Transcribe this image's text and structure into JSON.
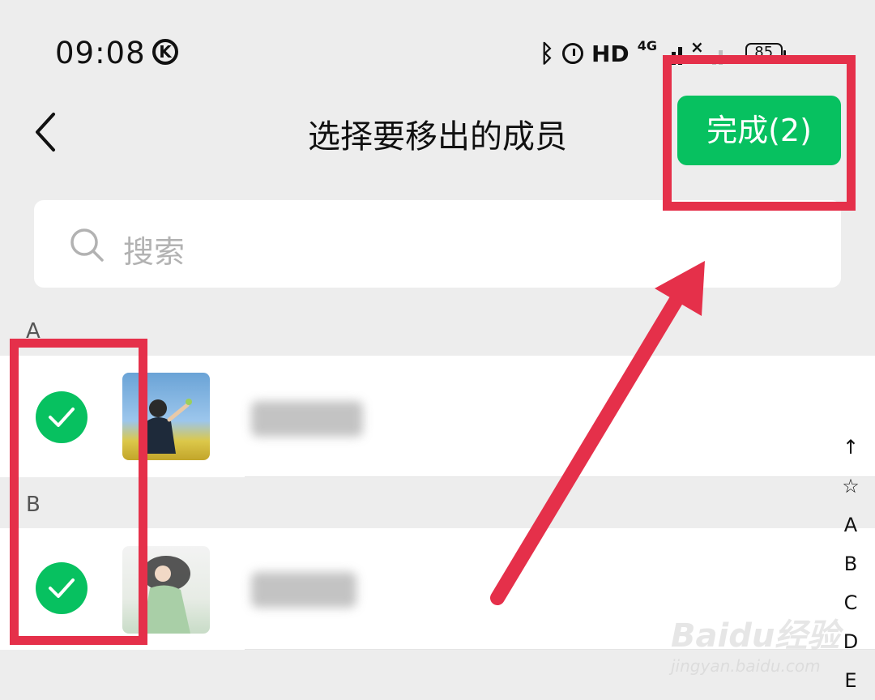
{
  "status_bar": {
    "time": "09:08",
    "k_badge": "K",
    "hd": "HD",
    "network": "4G",
    "battery": "85"
  },
  "nav": {
    "title": "选择要移出的成员",
    "done_label": "完成(2)"
  },
  "search": {
    "placeholder": "搜索"
  },
  "sections": [
    {
      "letter": "A",
      "member": {
        "name": "",
        "selected": true
      }
    },
    {
      "letter": "B",
      "member": {
        "name": "",
        "selected": true
      }
    }
  ],
  "index_bar": [
    "↑",
    "☆",
    "A",
    "B",
    "C",
    "D",
    "E"
  ],
  "watermark": {
    "brand": "Baidu经验",
    "url": "jingyan.baidu.com"
  },
  "colors": {
    "accent": "#07c160",
    "annotation": "#e5304a",
    "background": "#ededed"
  }
}
